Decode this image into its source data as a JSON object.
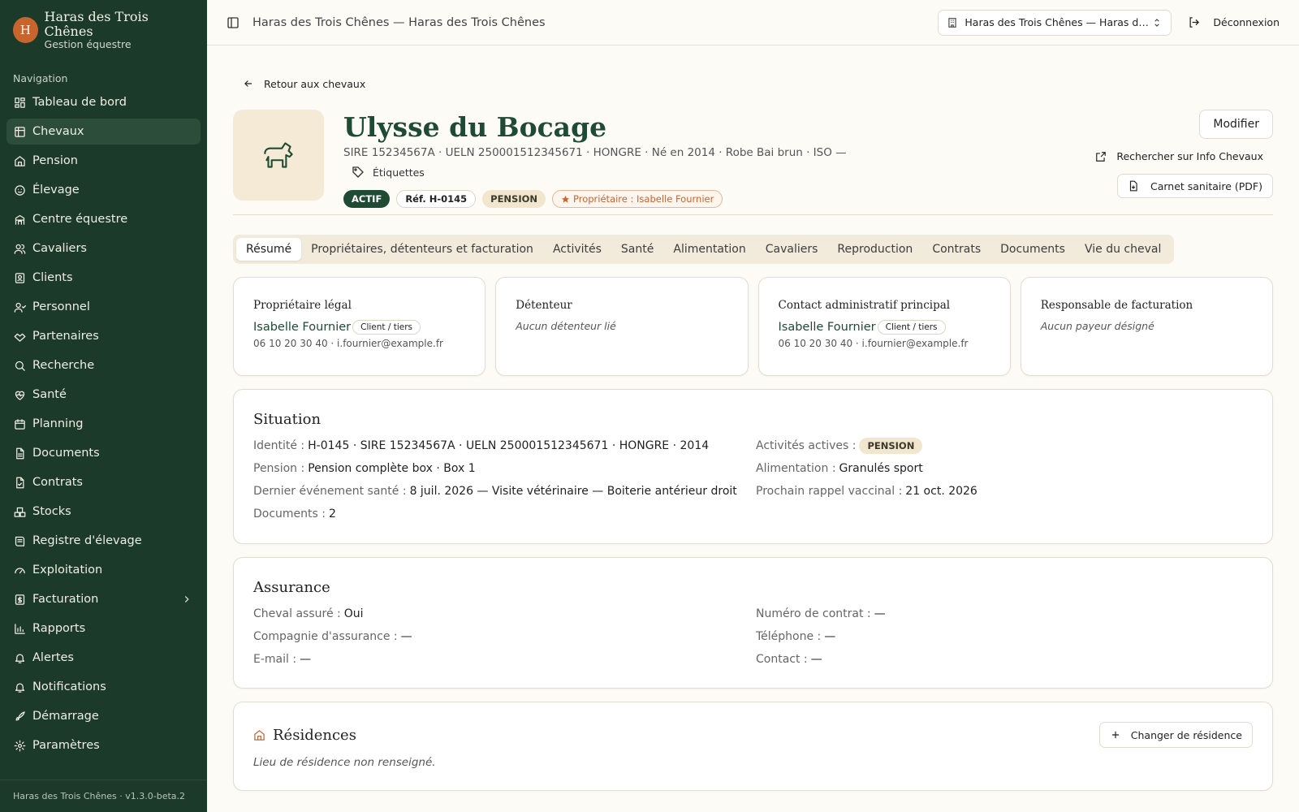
{
  "brand": {
    "initial": "H",
    "name": "Haras des Trois Chênes",
    "subtitle": "Gestion équestre"
  },
  "nav": {
    "section_label": "Navigation",
    "items": [
      {
        "label": "Tableau de bord",
        "icon": "dashboard-icon"
      },
      {
        "label": "Chevaux",
        "icon": "horse-icon",
        "active": true
      },
      {
        "label": "Pension",
        "icon": "home-icon"
      },
      {
        "label": "Élevage",
        "icon": "baby-icon"
      },
      {
        "label": "Centre équestre",
        "icon": "school-icon"
      },
      {
        "label": "Cavaliers",
        "icon": "users-icon"
      },
      {
        "label": "Clients",
        "icon": "contact-icon"
      },
      {
        "label": "Personnel",
        "icon": "staff-icon"
      },
      {
        "label": "Partenaires",
        "icon": "handshake-icon"
      },
      {
        "label": "Recherche",
        "icon": "search-icon"
      },
      {
        "label": "Santé",
        "icon": "heart-pulse-icon"
      },
      {
        "label": "Planning",
        "icon": "calendar-icon"
      },
      {
        "label": "Documents",
        "icon": "file-icon"
      },
      {
        "label": "Contrats",
        "icon": "contract-icon"
      },
      {
        "label": "Stocks",
        "icon": "boxes-icon"
      },
      {
        "label": "Registre d'élevage",
        "icon": "book-icon"
      },
      {
        "label": "Exploitation",
        "icon": "gauge-icon"
      },
      {
        "label": "Facturation",
        "icon": "invoice-icon",
        "has_submenu": true
      },
      {
        "label": "Rapports",
        "icon": "chart-icon"
      },
      {
        "label": "Alertes",
        "icon": "bell-icon"
      },
      {
        "label": "Notifications",
        "icon": "notification-icon"
      },
      {
        "label": "Démarrage",
        "icon": "rocket-icon"
      },
      {
        "label": "Paramètres",
        "icon": "gear-icon"
      }
    ],
    "footer": "Haras des Trois Chênes · v1.3.0-beta.2"
  },
  "topbar": {
    "title": "Haras des Trois Chênes — Haras des Trois Chênes",
    "site_select": "Haras des Trois Chênes — Haras de...",
    "logout": "Déconnexion"
  },
  "back_link": "Retour aux chevaux",
  "horse": {
    "name": "Ulysse du Bocage",
    "meta": "SIRE 15234567A · UELN 250001512345671 · HONGRE · Né en 2014 · Robe Bai brun · ISO —",
    "tags_label": "Étiquettes",
    "badges": {
      "status": "ACTIF",
      "ref": "Réf. H-0145",
      "activity": "PENSION",
      "owner": "Propriétaire : Isabelle Fournier"
    }
  },
  "actions": {
    "edit": "Modifier",
    "info_chevaux": "Rechercher sur Info Chevaux",
    "health_pdf": "Carnet sanitaire (PDF)"
  },
  "tabs": [
    {
      "label": "Résumé",
      "active": true
    },
    {
      "label": "Propriétaires, détenteurs et facturation"
    },
    {
      "label": "Activités"
    },
    {
      "label": "Santé"
    },
    {
      "label": "Alimentation"
    },
    {
      "label": "Cavaliers"
    },
    {
      "label": "Reproduction"
    },
    {
      "label": "Contrats"
    },
    {
      "label": "Documents"
    },
    {
      "label": "Vie du cheval"
    }
  ],
  "parties": {
    "owner": {
      "title": "Propriétaire légal",
      "name": "Isabelle Fournier",
      "badge": "Client / tiers",
      "contact": "06 10 20 30 40 · i.fournier@example.fr"
    },
    "holder": {
      "title": "Détenteur",
      "empty": "Aucun détenteur lié"
    },
    "admin": {
      "title": "Contact administratif principal",
      "name": "Isabelle Fournier",
      "badge": "Client / tiers",
      "contact": "06 10 20 30 40 · i.fournier@example.fr"
    },
    "billing": {
      "title": "Responsable de facturation",
      "empty": "Aucun payeur désigné"
    }
  },
  "situation": {
    "title": "Situation",
    "identity_label": "Identité :",
    "identity_value": "H-0145 · SIRE 15234567A · UELN 250001512345671 · HONGRE · 2014",
    "activities_label": "Activités actives :",
    "activities_value": "PENSION",
    "pension_label": "Pension :",
    "pension_value": "Pension complète box · Box 1",
    "feed_label": "Alimentation :",
    "feed_value": "Granulés sport",
    "health_label": "Dernier événement santé :",
    "health_value": "8 juil. 2026 — Visite vétérinaire — Boiterie antérieur droit",
    "vaccine_label": "Prochain rappel vaccinal :",
    "vaccine_value": "21 oct. 2026",
    "docs_label": "Documents :",
    "docs_value": "2"
  },
  "insurance": {
    "title": "Assurance",
    "insured_label": "Cheval assuré :",
    "insured_value": "Oui",
    "contract_label": "Numéro de contrat :",
    "contract_value": "—",
    "company_label": "Compagnie d'assurance :",
    "company_value": "—",
    "phone_label": "Téléphone :",
    "phone_value": "—",
    "email_label": "E-mail :",
    "email_value": "—",
    "contact_label": "Contact :",
    "contact_value": "—"
  },
  "residences": {
    "title": "Résidences",
    "change_button": "Changer de résidence",
    "empty": "Lieu de résidence non renseigné."
  },
  "colors": {
    "sidebar": "#1b3a2a",
    "accent": "#1f4a33",
    "orange": "#c8652e",
    "background": "#fdfbf6"
  }
}
